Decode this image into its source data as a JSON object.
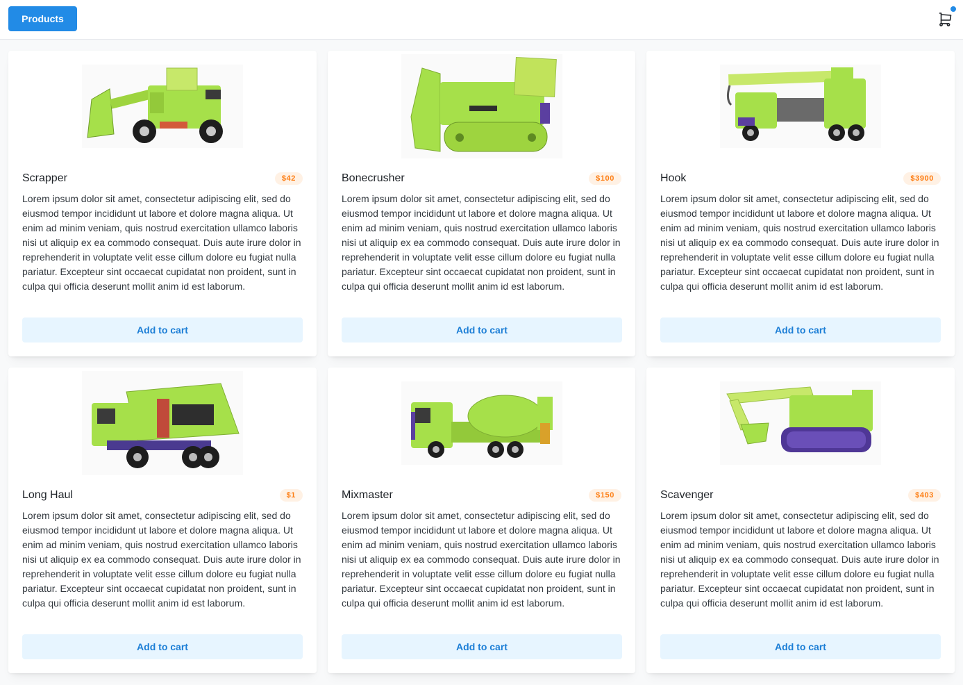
{
  "nav": {
    "products_label": "Products"
  },
  "cart": {
    "icon": "shopping-cart-icon",
    "indicator_color": "#228be6"
  },
  "colors": {
    "accent": "#228be6",
    "badge_text": "#fd7e14",
    "badge_bg": "#fff1e4",
    "toy_green": "#a6e04a",
    "toy_purple": "#5b3fa0"
  },
  "products": [
    {
      "name": "Scrapper",
      "price": "$42",
      "image": "front-loader-toy-image",
      "description": "Lorem ipsum dolor sit amet, consectetur adipiscing elit, sed do eiusmod tempor incididunt ut labore et dolore magna aliqua. Ut enim ad minim veniam, quis nostrud exercitation ullamco laboris nisi ut aliquip ex ea commodo consequat. Duis aute irure dolor in reprehenderit in voluptate velit esse cillum dolore eu fugiat nulla pariatur. Excepteur sint occaecat cupidatat non proident, sunt in culpa qui officia deserunt mollit anim id est laborum.",
      "button": "Add to cart"
    },
    {
      "name": "Bonecrusher",
      "price": "$100",
      "image": "bulldozer-toy-image",
      "description": "Lorem ipsum dolor sit amet, consectetur adipiscing elit, sed do eiusmod tempor incididunt ut labore et dolore magna aliqua. Ut enim ad minim veniam, quis nostrud exercitation ullamco laboris nisi ut aliquip ex ea commodo consequat. Duis aute irure dolor in reprehenderit in voluptate velit esse cillum dolore eu fugiat nulla pariatur. Excepteur sint occaecat cupidatat non proident, sunt in culpa qui officia deserunt mollit anim id est laborum.",
      "button": "Add to cart"
    },
    {
      "name": "Hook",
      "price": "$3900",
      "image": "crane-truck-toy-image",
      "description": "Lorem ipsum dolor sit amet, consectetur adipiscing elit, sed do eiusmod tempor incididunt ut labore et dolore magna aliqua. Ut enim ad minim veniam, quis nostrud exercitation ullamco laboris nisi ut aliquip ex ea commodo consequat. Duis aute irure dolor in reprehenderit in voluptate velit esse cillum dolore eu fugiat nulla pariatur. Excepteur sint occaecat cupidatat non proident, sunt in culpa qui officia deserunt mollit anim id est laborum.",
      "button": "Add to cart"
    },
    {
      "name": "Long Haul",
      "price": "$1",
      "image": "dump-truck-toy-image",
      "description": "Lorem ipsum dolor sit amet, consectetur adipiscing elit, sed do eiusmod tempor incididunt ut labore et dolore magna aliqua. Ut enim ad minim veniam, quis nostrud exercitation ullamco laboris nisi ut aliquip ex ea commodo consequat. Duis aute irure dolor in reprehenderit in voluptate velit esse cillum dolore eu fugiat nulla pariatur. Excepteur sint occaecat cupidatat non proident, sunt in culpa qui officia deserunt mollit anim id est laborum.",
      "button": "Add to cart"
    },
    {
      "name": "Mixmaster",
      "price": "$150",
      "image": "cement-mixer-toy-image",
      "description": "Lorem ipsum dolor sit amet, consectetur adipiscing elit, sed do eiusmod tempor incididunt ut labore et dolore magna aliqua. Ut enim ad minim veniam, quis nostrud exercitation ullamco laboris nisi ut aliquip ex ea commodo consequat. Duis aute irure dolor in reprehenderit in voluptate velit esse cillum dolore eu fugiat nulla pariatur. Excepteur sint occaecat cupidatat non proident, sunt in culpa qui officia deserunt mollit anim id est laborum.",
      "button": "Add to cart"
    },
    {
      "name": "Scavenger",
      "price": "$403",
      "image": "excavator-toy-image",
      "description": "Lorem ipsum dolor sit amet, consectetur adipiscing elit, sed do eiusmod tempor incididunt ut labore et dolore magna aliqua. Ut enim ad minim veniam, quis nostrud exercitation ullamco laboris nisi ut aliquip ex ea commodo consequat. Duis aute irure dolor in reprehenderit in voluptate velit esse cillum dolore eu fugiat nulla pariatur. Excepteur sint occaecat cupidatat non proident, sunt in culpa qui officia deserunt mollit anim id est laborum.",
      "button": "Add to cart"
    }
  ]
}
